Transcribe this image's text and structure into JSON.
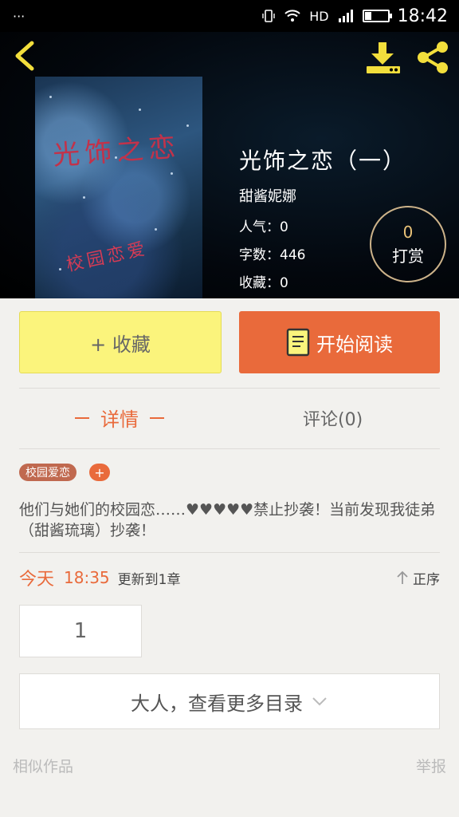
{
  "status_bar": {
    "notification_dots": "···",
    "network": "HD",
    "time": "18:42"
  },
  "book": {
    "cover_title": "光饰之恋",
    "cover_subtitle": "校园恋爱",
    "title": "光饰之恋（一）",
    "author": "甜酱妮娜",
    "popularity": "人气：0",
    "word_count": "字数：446",
    "favorites": "收藏：0"
  },
  "tip": {
    "count": "0",
    "label": "打赏"
  },
  "actions": {
    "collect": "+ 收藏",
    "read": "开始阅读"
  },
  "tabs": {
    "details": "详情",
    "comments": "评论(0)"
  },
  "tag": {
    "label": "校园爱恋",
    "add": "+"
  },
  "description": "他们与她们的校园恋……♥♥♥♥♥禁止抄袭！当前发现我徒弟（甜酱琉璃）抄袭！",
  "update": {
    "day": "今天",
    "time": "18:35",
    "label": "更新到1章",
    "sort": "正序"
  },
  "chapter": {
    "first": "1"
  },
  "more_catalog": "大人，查看更多目录",
  "footer": {
    "similar": "相似作品",
    "report": "举报"
  },
  "colors": {
    "accent": "#e96a3b",
    "collect_bg": "#fbf47c",
    "icon_yellow": "#f2de3c"
  },
  "icons": {
    "back": "chevron-left-icon",
    "download": "download-icon",
    "share": "share-icon",
    "book": "book-icon",
    "sort": "arrow-up-icon",
    "expand": "chevron-down-icon"
  }
}
